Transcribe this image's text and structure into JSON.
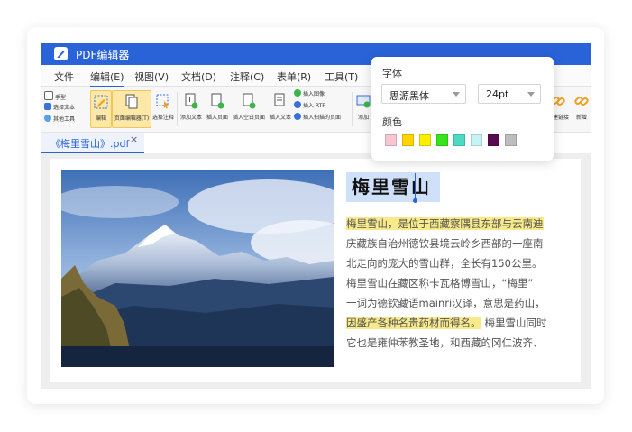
{
  "window": {
    "title": "PDF编辑器"
  },
  "menu": {
    "items": [
      {
        "label": "文件"
      },
      {
        "label": "编辑(E)"
      },
      {
        "label": "视图(V)"
      },
      {
        "label": "文档(D)"
      },
      {
        "label": "注释(C)"
      },
      {
        "label": "表单(R)"
      },
      {
        "label": "工具(T)"
      }
    ],
    "active_index": 1
  },
  "ribbon": {
    "small_tools": [
      {
        "label": "手型",
        "icon": "hand-icon"
      },
      {
        "label": "选择文本",
        "icon": "text-select-icon"
      },
      {
        "label": "其他工具",
        "icon": "tools-icon"
      }
    ],
    "buttons": [
      {
        "label": "编辑",
        "icon": "edit-icon",
        "selected": true
      },
      {
        "label": "页面编辑器(T)",
        "icon": "page-editor-icon",
        "selected": true
      },
      {
        "label": "选择注释",
        "icon": "select-annotation-icon"
      },
      {
        "label": "添加文本",
        "icon": "add-text-icon"
      },
      {
        "label": "插入页面",
        "icon": "insert-page-icon"
      },
      {
        "label": "插入空白页面",
        "icon": "insert-blank-page-icon"
      },
      {
        "label": "插入文本",
        "icon": "insert-text-icon"
      }
    ],
    "insert_tools": [
      {
        "label": "插入图像",
        "icon": "insert-image-icon"
      },
      {
        "label": "插入 RTF",
        "icon": "insert-rtf-icon"
      },
      {
        "label": "插入扫描的页面",
        "icon": "insert-scan-icon"
      }
    ],
    "partial_right": [
      {
        "label": "添加",
        "icon": "add-icon"
      },
      {
        "label": "创建链接",
        "icon": "link-icon"
      },
      {
        "label": "新增",
        "icon": "link-new-icon"
      }
    ]
  },
  "tab": {
    "label": "《梅里雪山》.pdf",
    "close": "×"
  },
  "document": {
    "title": "梅里雪山",
    "lines": [
      {
        "text": "梅里雪山，是位于西藏察隅县东部与云南迪",
        "highlight": true,
        "rest": ""
      },
      {
        "text": "庆藏族自治州德钦县境云岭乡西部的一座南",
        "highlight": false,
        "rest": ""
      },
      {
        "text": "北走向的庞大的雪山群，全长有150公里。",
        "highlight": false,
        "rest": ""
      },
      {
        "text": "梅里雪山在藏区称卡瓦格博雪山，“梅里”",
        "highlight": false,
        "rest": ""
      },
      {
        "text": "一词为德钦藏语mainri汉译，意思是药山，",
        "highlight": false,
        "rest": ""
      },
      {
        "text": "因盛产各种名贵药材而得名。",
        "highlight": true,
        "rest": "梅里雪山同时"
      },
      {
        "text": "它也是雍仲苯教圣地，和西藏的冈仁波齐、",
        "highlight": false,
        "rest": ""
      }
    ]
  },
  "font_popup": {
    "font_label": "字体",
    "font_value": "思源黑体",
    "size_value": "24pt",
    "color_label": "颜色",
    "colors": [
      "#f7c6d0",
      "#ffd400",
      "#ffee00",
      "#33e51a",
      "#4dd9c2",
      "#c6f3f3",
      "#5a0a52",
      "#bdbdbd"
    ]
  }
}
